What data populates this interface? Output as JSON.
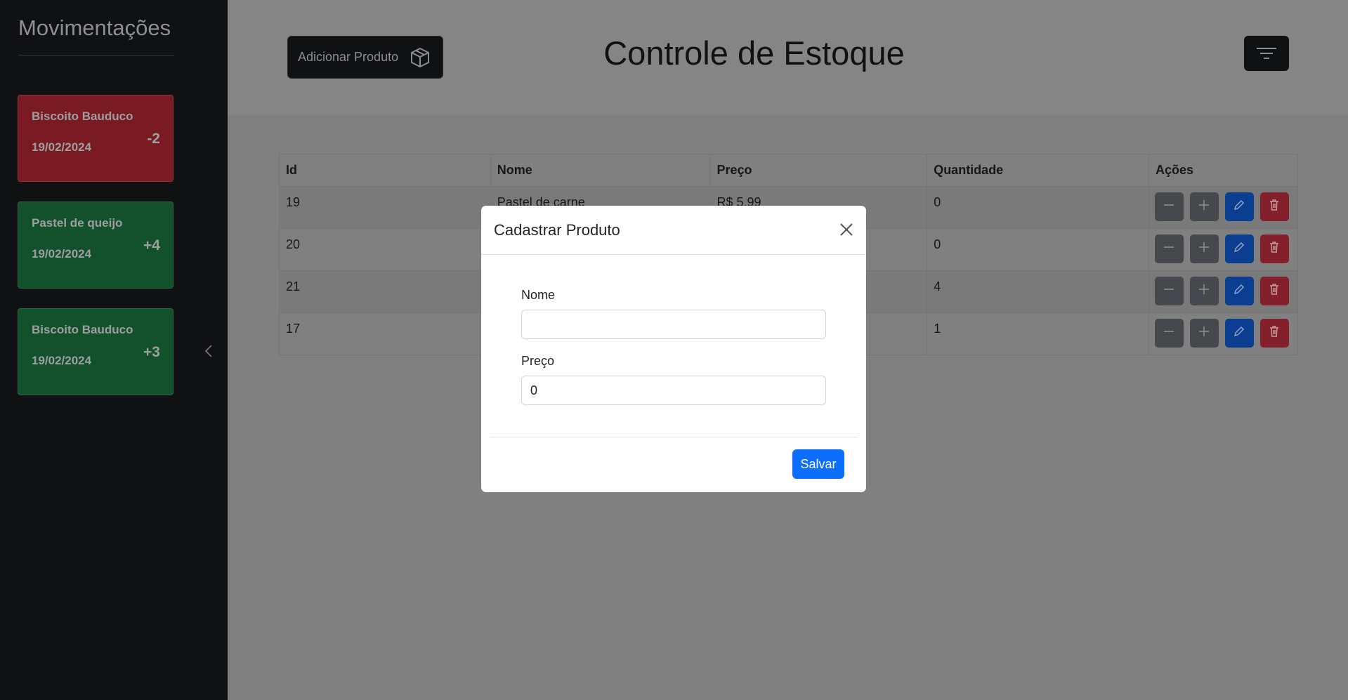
{
  "sidebar": {
    "title": "Movimentações",
    "movements": [
      {
        "name": "Biscoito Bauduco",
        "date": "19/02/2024",
        "qty": "-2",
        "type": "out"
      },
      {
        "name": "Pastel de queijo",
        "date": "19/02/2024",
        "qty": "+4",
        "type": "in"
      },
      {
        "name": "Biscoito Bauduco",
        "date": "19/02/2024",
        "qty": "+3",
        "type": "in"
      }
    ],
    "collapse_icon": "chevron-left-icon"
  },
  "header": {
    "add_button_label": "Adicionar Produto",
    "add_button_icon": "box-icon",
    "title": "Controle de Estoque",
    "filter_icon": "filter-icon"
  },
  "table": {
    "columns": [
      "Id",
      "Nome",
      "Preço",
      "Quantidade",
      "Ações"
    ],
    "rows": [
      {
        "id": "19",
        "nome": "Pastel de carne",
        "preco": "R$ 5.99",
        "quantidade": "0"
      },
      {
        "id": "20",
        "nome": "",
        "preco": "",
        "quantidade": "0"
      },
      {
        "id": "21",
        "nome": "",
        "preco": "",
        "quantidade": "4"
      },
      {
        "id": "17",
        "nome": "",
        "preco": "",
        "quantidade": "1"
      }
    ]
  },
  "modal": {
    "title": "Cadastrar Produto",
    "fields": [
      {
        "label": "Nome",
        "value": ""
      },
      {
        "label": "Preço",
        "value": "0"
      }
    ],
    "save_label": "Salvar"
  },
  "colors": {
    "sidebar_bg": "#101113",
    "card_negative": "#7a1b24",
    "card_positive": "#13502c",
    "primary": "#0d6efd",
    "overlay": "#808080"
  }
}
